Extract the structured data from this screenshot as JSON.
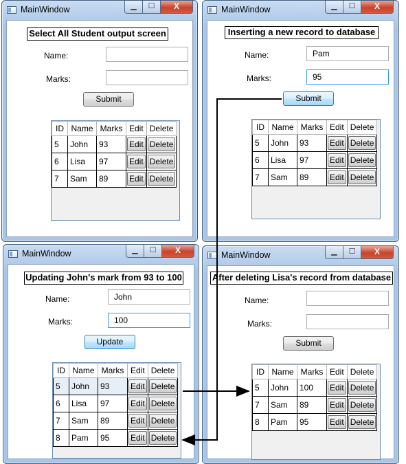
{
  "windows": [
    {
      "title": "MainWindow",
      "heading": "Select All Student output screen",
      "name_label": "Name:",
      "marks_label": "Marks:",
      "name_value": "",
      "marks_value": "",
      "button_label": "Submit",
      "columns": [
        "ID",
        "Name",
        "Marks",
        "Edit",
        "Delete"
      ],
      "rows": [
        {
          "id": "5",
          "name": "John",
          "marks": "93"
        },
        {
          "id": "6",
          "name": "Lisa",
          "marks": "97"
        },
        {
          "id": "7",
          "name": "Sam",
          "marks": "89"
        }
      ],
      "edit_label": "Edit",
      "delete_label": "Delete"
    },
    {
      "title": "MainWindow",
      "heading": "Inserting a new record to database",
      "name_label": "Name:",
      "marks_label": "Marks:",
      "name_value": "Pam",
      "marks_value": "95",
      "button_label": "Submit",
      "columns": [
        "ID",
        "Name",
        "Marks",
        "Edit",
        "Delete"
      ],
      "rows": [
        {
          "id": "5",
          "name": "John",
          "marks": "93"
        },
        {
          "id": "6",
          "name": "Lisa",
          "marks": "97"
        },
        {
          "id": "7",
          "name": "Sam",
          "marks": "89"
        }
      ],
      "edit_label": "Edit",
      "delete_label": "Delete"
    },
    {
      "title": "MainWindow",
      "heading": "Updating John's mark from 93 to 100",
      "name_label": "Name:",
      "marks_label": "Marks:",
      "name_value": "John",
      "marks_value": "100",
      "button_label": "Update",
      "columns": [
        "ID",
        "Name",
        "Marks",
        "Edit",
        "Delete"
      ],
      "rows": [
        {
          "id": "5",
          "name": "John",
          "marks": "93"
        },
        {
          "id": "6",
          "name": "Lisa",
          "marks": "97"
        },
        {
          "id": "7",
          "name": "Sam",
          "marks": "89"
        },
        {
          "id": "8",
          "name": "Pam",
          "marks": "95"
        }
      ],
      "edit_label": "Edit",
      "delete_label": "Delete"
    },
    {
      "title": "MainWindow",
      "heading": "After deleting Lisa's record from database",
      "name_label": "Name:",
      "marks_label": "Marks:",
      "name_value": "",
      "marks_value": "",
      "button_label": "Submit",
      "columns": [
        "ID",
        "Name",
        "Marks",
        "Edit",
        "Delete"
      ],
      "rows": [
        {
          "id": "5",
          "name": "John",
          "marks": "100"
        },
        {
          "id": "7",
          "name": "Sam",
          "marks": "89"
        },
        {
          "id": "8",
          "name": "Pam",
          "marks": "95"
        }
      ],
      "edit_label": "Edit",
      "delete_label": "Delete"
    }
  ],
  "window_controls": {
    "minimize": "▁",
    "maximize": "☐",
    "close": "X"
  },
  "colors": {
    "arrow": "#000000",
    "focus_border": "#3399ff",
    "close_button": "#c9432b"
  }
}
